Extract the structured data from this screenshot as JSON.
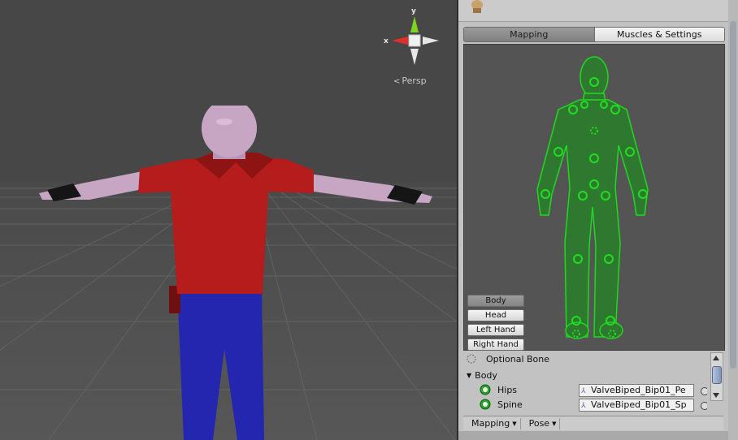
{
  "scene": {
    "axis_x_label": "x",
    "axis_y_label": "y",
    "projection_label": "Persp",
    "icons": {
      "projection": "chevron-left-icon"
    }
  },
  "inspector": {
    "tabs": [
      {
        "label": "Mapping",
        "active": true
      },
      {
        "label": "Muscles & Settings",
        "active": false
      }
    ],
    "body_parts": [
      {
        "label": "Body",
        "active": true
      },
      {
        "label": "Head",
        "active": false
      },
      {
        "label": "Left Hand",
        "active": false
      },
      {
        "label": "Right Hand",
        "active": false
      }
    ],
    "bone_list": {
      "optional_label": "Optional Bone",
      "group_label": "Body",
      "bones": [
        {
          "name": "Hips",
          "value": "ValveBiped_Bip01_Pe"
        },
        {
          "name": "Spine",
          "value": "ValveBiped_Bip01_Sp"
        }
      ]
    },
    "bottom_menus": {
      "mapping": "Mapping",
      "pose": "Pose"
    }
  },
  "colors": {
    "scene_bg": "#474747",
    "inspector_bg": "#c2c2c2",
    "avatar_green": "#1ee01e",
    "shirt": "#b51c1c",
    "pants": "#2426b0",
    "x_axis": "#e0302a",
    "y_axis": "#7ed321"
  }
}
